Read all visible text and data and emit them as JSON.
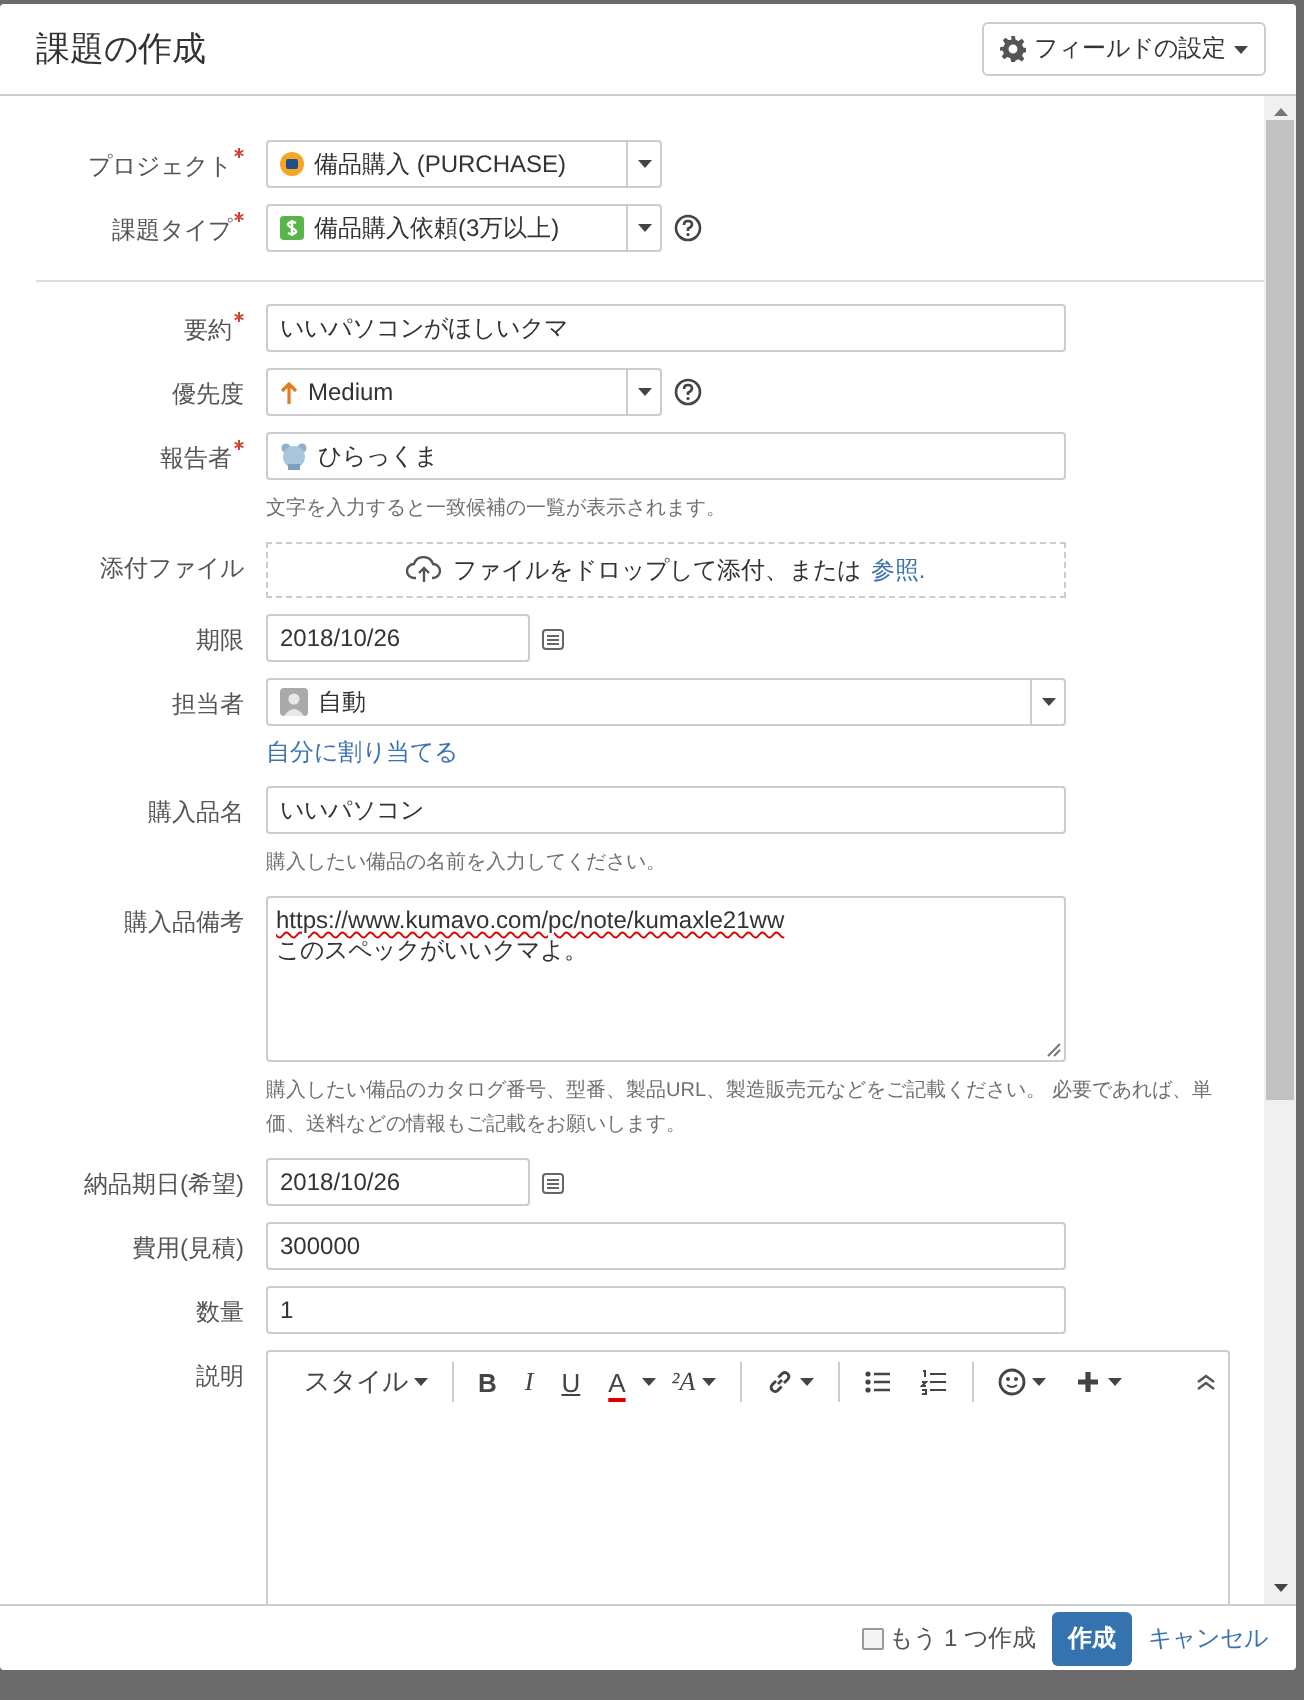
{
  "dialog": {
    "title": "課題の作成",
    "settings_button": "フィールドの設定"
  },
  "sections": [
    {
      "fields": [
        {
          "kind": "project-select",
          "label": "プロジェクト",
          "required": true,
          "value": "備品購入 (PURCHASE)"
        },
        {
          "kind": "type-select",
          "label": "課題タイプ",
          "required": true,
          "value": "備品購入依頼(3万以上)",
          "help": true
        }
      ]
    },
    {
      "fields": [
        {
          "kind": "text",
          "label": "要約",
          "required": true,
          "value": "いいパソコンがほしいクマ"
        },
        {
          "kind": "priority-select",
          "label": "優先度",
          "value": "Medium",
          "help": true
        },
        {
          "kind": "user",
          "label": "報告者",
          "required": true,
          "value": "ひらっくま",
          "hint": "文字を入力すると一致候補の一覧が表示されます。"
        },
        {
          "kind": "attachment",
          "label": "添付ファイル",
          "text": "ファイルをドロップして添付、または",
          "link": "参照."
        },
        {
          "kind": "date",
          "label": "期限",
          "value": "2018/10/26"
        },
        {
          "kind": "user-select",
          "label": "担当者",
          "value": "自動",
          "link": "自分に割り当てる"
        },
        {
          "kind": "text",
          "label": "購入品名",
          "value": "いいパソコン",
          "hint": "購入したい備品の名前を入力してください。"
        },
        {
          "kind": "textarea",
          "label": "購入品備考",
          "lines": [
            "https://www.kumavo.com/pc/note/kumaxle21ww",
            "このスペックがいいクマよ。"
          ],
          "hint": "購入したい備品のカタログ番号、型番、製品URL、製造販売元などをご記載ください。 必要であれば、単価、送料などの情報もご記載をお願いします。"
        },
        {
          "kind": "date",
          "label": "納品期日(希望)",
          "value": "2018/10/26"
        },
        {
          "kind": "text",
          "label": "費用(見積)",
          "value": "300000"
        },
        {
          "kind": "text",
          "label": "数量",
          "value": "1"
        },
        {
          "kind": "editor",
          "label": "説明",
          "toolbar": [
            [
              {
                "kind": "style",
                "label": "スタイル"
              }
            ],
            [
              {
                "kind": "bold",
                "label": "B"
              },
              {
                "kind": "italic",
                "label": "I"
              },
              {
                "kind": "underline",
                "label": "U"
              },
              {
                "kind": "color",
                "label": "A"
              },
              {
                "kind": "size",
                "label": "²A"
              }
            ],
            [
              {
                "kind": "link"
              }
            ],
            [
              {
                "kind": "bullets"
              },
              {
                "kind": "numbers"
              }
            ],
            [
              {
                "kind": "emoji"
              },
              {
                "kind": "insert"
              }
            ]
          ]
        }
      ]
    }
  ],
  "footer": {
    "another": {
      "label": "もう 1 つ作成",
      "checked": false
    },
    "create_button": "作成",
    "cancel_link": "キャンセル"
  }
}
